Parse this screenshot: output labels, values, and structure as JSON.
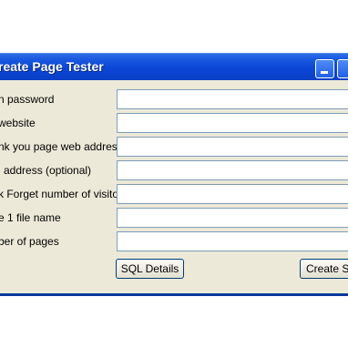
{
  "window": {
    "title": "reate Page Tester"
  },
  "form": {
    "rows": [
      {
        "label": "n password",
        "value": ""
      },
      {
        "label": "website",
        "value": ""
      },
      {
        "label": "nk you page web address",
        "value": ""
      },
      {
        "label": "l address (optional)",
        "value": ""
      },
      {
        "label": "k Forget number of visitors",
        "value": ""
      },
      {
        "label": "e 1 file name",
        "value": ""
      },
      {
        "label": "ber of pages",
        "value": ""
      }
    ]
  },
  "buttons": {
    "sql_details": "SQL Details",
    "create": "Create Sc"
  }
}
